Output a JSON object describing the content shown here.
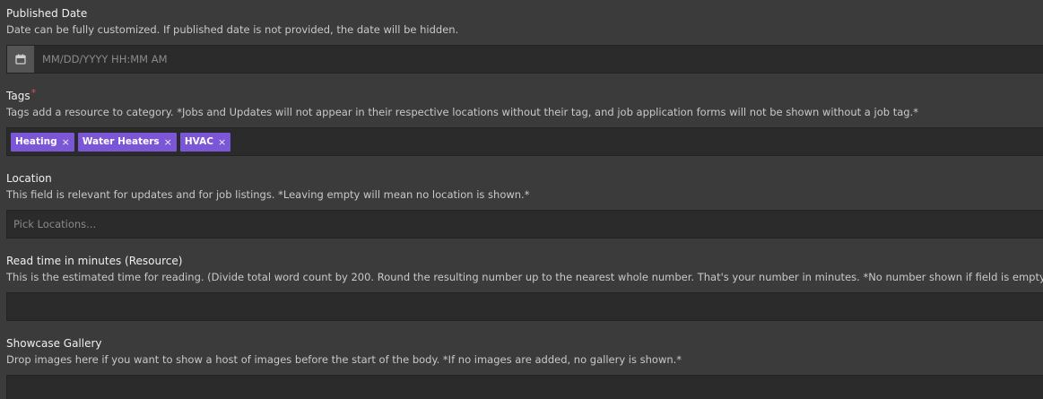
{
  "published_date": {
    "label": "Published Date",
    "description": "Date can be fully customized. If published date is not provided, the date will be hidden.",
    "placeholder": "MM/DD/YYYY HH:MM AM",
    "icon": "calendar-icon"
  },
  "tags": {
    "label": "Tags",
    "required_marker": "*",
    "description": "Tags add a resource to category. *Jobs and Updates will not appear in their respective locations without their tag, and job application forms will not be shown without a job tag.*",
    "items": [
      {
        "label": "Heating",
        "remove": "×"
      },
      {
        "label": "Water Heaters",
        "remove": "×"
      },
      {
        "label": "HVAC",
        "remove": "×"
      }
    ],
    "tag_color": "#7b56d6"
  },
  "location": {
    "label": "Location",
    "description": "This field is relevant for updates and for job listings. *Leaving empty will mean no location is shown.*",
    "placeholder": "Pick Locations..."
  },
  "read_time": {
    "label": "Read time in minutes (Resource)",
    "description": "This is the estimated time for reading. (Divide total word count by 200. Round the resulting number up to the nearest whole number. That's your number in minutes. *No number shown if field is empty.*",
    "value": ""
  },
  "showcase_gallery": {
    "label": "Showcase Gallery",
    "description": "Drop images here if you want to show a host of images before the start of the body. *If no images are added, no gallery is shown.*"
  }
}
